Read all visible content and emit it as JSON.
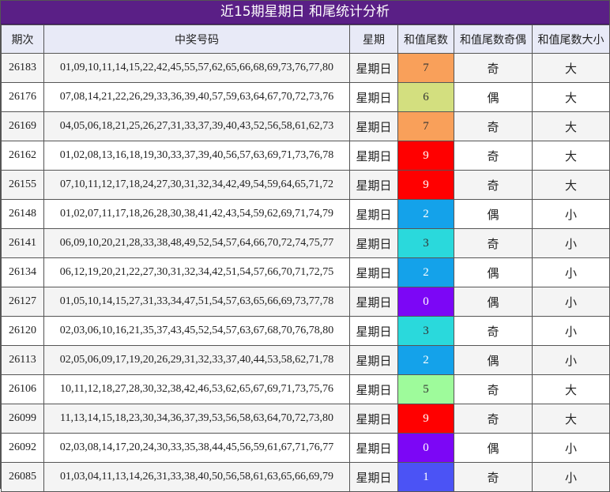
{
  "title": "近15期星期日 和尾统计分析",
  "headers": {
    "period": "期次",
    "numbers": "中奖号码",
    "weekday": "星期",
    "tail": "和值尾数",
    "odd_even": "和值尾数奇偶",
    "big_small": "和值尾数大小"
  },
  "tail_colors": {
    "orange": "#f9a05a",
    "khaki": "#d3df7f",
    "red": "#ff0000",
    "blue": "#14a2ea",
    "cyan": "#2ad9dc",
    "purple": "#7c06f6",
    "green": "#9efb9b",
    "indigo": "#4b53f5"
  },
  "rows": [
    {
      "period": "26183",
      "numbers": "01,09,10,11,14,15,22,42,45,55,57,62,65,66,68,69,73,76,77,80",
      "weekday": "星期日",
      "tail": "7",
      "tail_color": "orange",
      "odd_even": "奇",
      "big_small": "大"
    },
    {
      "period": "26176",
      "numbers": "07,08,14,21,22,26,29,33,36,39,40,57,59,63,64,67,70,72,73,76",
      "weekday": "星期日",
      "tail": "6",
      "tail_color": "khaki",
      "odd_even": "偶",
      "big_small": "大"
    },
    {
      "period": "26169",
      "numbers": "04,05,06,18,21,25,26,27,31,33,37,39,40,43,52,56,58,61,62,73",
      "weekday": "星期日",
      "tail": "7",
      "tail_color": "orange",
      "odd_even": "奇",
      "big_small": "大"
    },
    {
      "period": "26162",
      "numbers": "01,02,08,13,16,18,19,30,33,37,39,40,56,57,63,69,71,73,76,78",
      "weekday": "星期日",
      "tail": "9",
      "tail_color": "red",
      "odd_even": "奇",
      "big_small": "大"
    },
    {
      "period": "26155",
      "numbers": "07,10,11,12,17,18,24,27,30,31,32,34,42,49,54,59,64,65,71,72",
      "weekday": "星期日",
      "tail": "9",
      "tail_color": "red",
      "odd_even": "奇",
      "big_small": "大"
    },
    {
      "period": "26148",
      "numbers": "01,02,07,11,17,18,26,28,30,38,41,42,43,54,59,62,69,71,74,79",
      "weekday": "星期日",
      "tail": "2",
      "tail_color": "blue",
      "odd_even": "偶",
      "big_small": "小"
    },
    {
      "period": "26141",
      "numbers": "06,09,10,20,21,28,33,38,48,49,52,54,57,64,66,70,72,74,75,77",
      "weekday": "星期日",
      "tail": "3",
      "tail_color": "cyan",
      "odd_even": "奇",
      "big_small": "小"
    },
    {
      "period": "26134",
      "numbers": "06,12,19,20,21,22,27,30,31,32,34,42,51,54,57,66,70,71,72,75",
      "weekday": "星期日",
      "tail": "2",
      "tail_color": "blue",
      "odd_even": "偶",
      "big_small": "小"
    },
    {
      "period": "26127",
      "numbers": "01,05,10,14,15,27,31,33,34,47,51,54,57,63,65,66,69,73,77,78",
      "weekday": "星期日",
      "tail": "0",
      "tail_color": "purple",
      "odd_even": "偶",
      "big_small": "小"
    },
    {
      "period": "26120",
      "numbers": "02,03,06,10,16,21,35,37,43,45,52,54,57,63,67,68,70,76,78,80",
      "weekday": "星期日",
      "tail": "3",
      "tail_color": "cyan",
      "odd_even": "奇",
      "big_small": "小"
    },
    {
      "period": "26113",
      "numbers": "02,05,06,09,17,19,20,26,29,31,32,33,37,40,44,53,58,62,71,78",
      "weekday": "星期日",
      "tail": "2",
      "tail_color": "blue",
      "odd_even": "偶",
      "big_small": "小"
    },
    {
      "period": "26106",
      "numbers": "10,11,12,18,27,28,30,32,38,42,46,53,62,65,67,69,71,73,75,76",
      "weekday": "星期日",
      "tail": "5",
      "tail_color": "green",
      "odd_even": "奇",
      "big_small": "大"
    },
    {
      "period": "26099",
      "numbers": "11,13,14,15,18,23,30,34,36,37,39,53,56,58,63,64,70,72,73,80",
      "weekday": "星期日",
      "tail": "9",
      "tail_color": "red",
      "odd_even": "奇",
      "big_small": "大"
    },
    {
      "period": "26092",
      "numbers": "02,03,08,14,17,20,24,30,33,35,38,44,45,56,59,61,67,71,76,77",
      "weekday": "星期日",
      "tail": "0",
      "tail_color": "purple",
      "odd_even": "偶",
      "big_small": "小"
    },
    {
      "period": "26085",
      "numbers": "01,03,04,11,13,14,26,31,33,38,40,50,56,58,61,63,65,66,69,79",
      "weekday": "星期日",
      "tail": "1",
      "tail_color": "indigo",
      "odd_even": "奇",
      "big_small": "小"
    }
  ]
}
